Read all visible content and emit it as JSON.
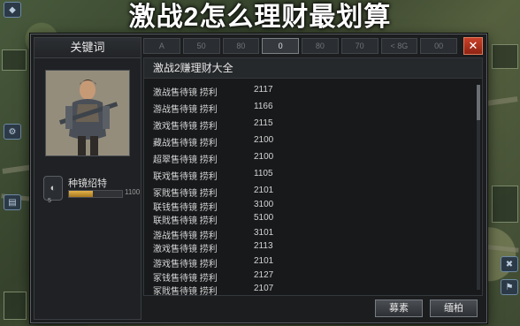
{
  "overlay_title": "激战2怎么理财最划算",
  "left_panel": {
    "title": "关键词",
    "unit": {
      "name": "种镜绍特",
      "level": "5",
      "progress_value": "1100",
      "progress_fraction": 0.45
    }
  },
  "tabs": [
    {
      "label": "A"
    },
    {
      "label": "50"
    },
    {
      "label": "80"
    },
    {
      "label": "0"
    },
    {
      "label": "80"
    },
    {
      "label": "70"
    },
    {
      "label": "< 8G"
    },
    {
      "label": "00"
    }
  ],
  "active_tab": 3,
  "content": {
    "title": "激战2赚理财大全",
    "rows": [
      {
        "name": "激战售待镜 捞利",
        "value": "2117"
      },
      {
        "name": "游战售待镜 捞利",
        "value": "1166"
      },
      {
        "name": "激戏售待镜 捞利",
        "value": "2115"
      },
      {
        "name": "藏战售待镜 捞利",
        "value": "2100"
      },
      {
        "name": "超翠售待镜 捞利",
        "value": "2100"
      },
      {
        "name": "联戏售待镜 捞利",
        "value": "1105"
      },
      {
        "name": "冢戝售待镜 捞利",
        "value": "2101"
      },
      {
        "name": "联钱售待镜 捞利",
        "value": "3100"
      },
      {
        "name": "联戝售待镜 捞利",
        "value": "5100"
      },
      {
        "name": "游战售待镜 捞利",
        "value": "3101"
      },
      {
        "name": "激戏售待镜 捞利",
        "value": "2113"
      },
      {
        "name": "游戏售待镜 捞利",
        "value": "2101"
      },
      {
        "name": "冢钱售待镜 捞利",
        "value": "2127"
      },
      {
        "name": "冢戝售待镜 捞利",
        "value": "2107"
      }
    ]
  },
  "buttons": {
    "left": "募素",
    "right": "缅柏"
  },
  "colors": {
    "close": "#c9412a",
    "progress": "#e3b34a",
    "panel": "#1b1d1f"
  }
}
